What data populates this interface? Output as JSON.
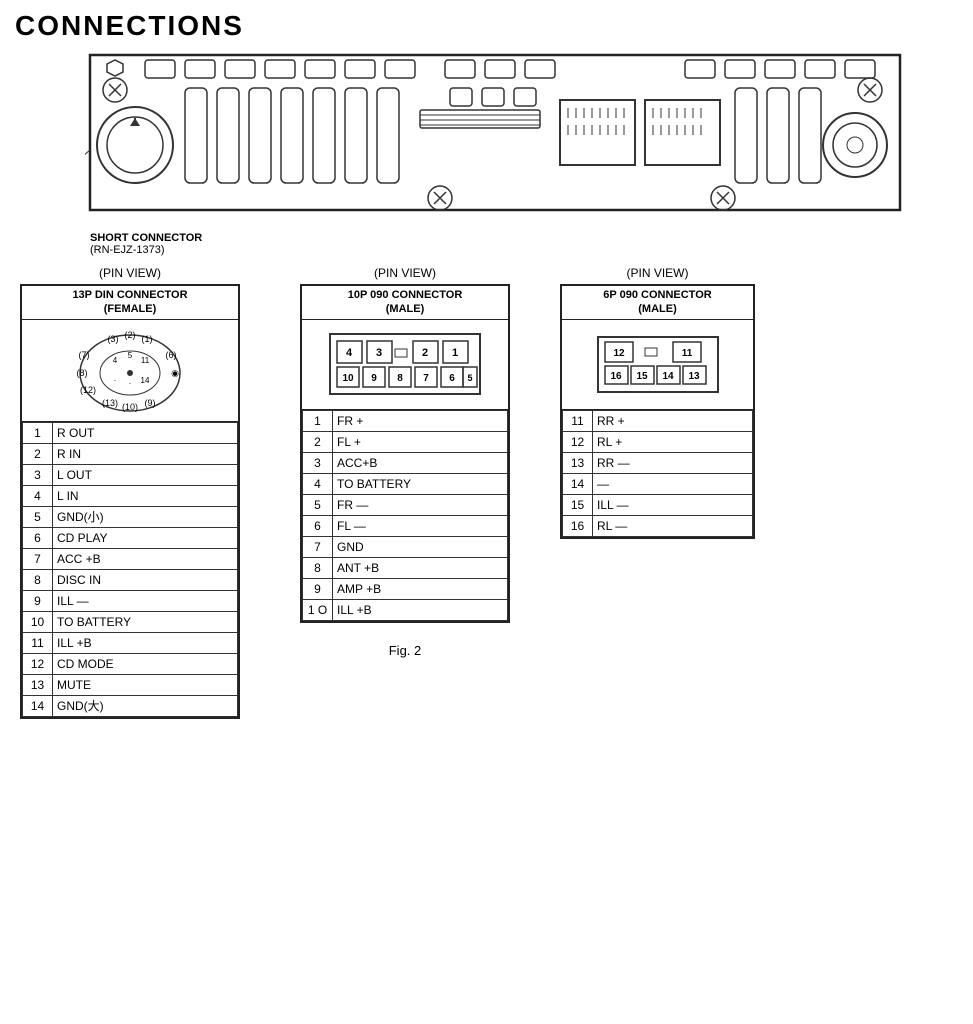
{
  "page": {
    "title": "CONNECTIONS",
    "fig_label": "Fig. 2",
    "short_connector": {
      "label_line1": "SHORT CONNECTOR",
      "label_line2": "(RN-EJZ-1373)"
    }
  },
  "pin_view_label": "(PIN  VIEW)",
  "connectors": [
    {
      "id": "13p-din",
      "title_line1": "13P DIN CONNECTOR",
      "title_line2": "(FEMALE)",
      "type": "din-circle",
      "pins": [
        {
          "num": "1",
          "label": "R OUT"
        },
        {
          "num": "2",
          "label": "R IN"
        },
        {
          "num": "3",
          "label": "L OUT"
        },
        {
          "num": "4",
          "label": "L IN"
        },
        {
          "num": "5",
          "label": "GND(小)"
        },
        {
          "num": "6",
          "label": "CD PLAY"
        },
        {
          "num": "7",
          "label": "ACC +B"
        },
        {
          "num": "8",
          "label": "DISC IN"
        },
        {
          "num": "9",
          "label": "ILL —"
        },
        {
          "num": "10",
          "label": "TO BATTERY"
        },
        {
          "num": "11",
          "label": "ILL +B"
        },
        {
          "num": "12",
          "label": "CD MODE"
        },
        {
          "num": "13",
          "label": "MUTE"
        },
        {
          "num": "14",
          "label": "GND(大)"
        }
      ]
    },
    {
      "id": "10p-090",
      "title_line1": "10P 090 CONNECTOR",
      "title_line2": "(MALE)",
      "type": "grid-10p",
      "grid_top": [
        "4",
        "3",
        "",
        "2",
        "1"
      ],
      "grid_bot": [
        "10",
        "9",
        "8",
        "7",
        "6",
        "5"
      ],
      "pins": [
        {
          "num": "1",
          "label": "FR +"
        },
        {
          "num": "2",
          "label": "FL +"
        },
        {
          "num": "3",
          "label": "ACC+B"
        },
        {
          "num": "4",
          "label": "TO BATTERY"
        },
        {
          "num": "5",
          "label": "FR —"
        },
        {
          "num": "6",
          "label": "FL —"
        },
        {
          "num": "7",
          "label": "GND"
        },
        {
          "num": "8",
          "label": "ANT +B"
        },
        {
          "num": "9",
          "label": "AMP +B"
        },
        {
          "num": "10",
          "label": "ILL +B"
        }
      ]
    },
    {
      "id": "6p-090",
      "title_line1": "6P 090 CONNECTOR",
      "title_line2": "(MALE)",
      "type": "grid-6p",
      "grid_top": [
        "12",
        "",
        "11"
      ],
      "grid_bot": [
        "16",
        "15",
        "14",
        "13"
      ],
      "pins": [
        {
          "num": "11",
          "label": "RR +"
        },
        {
          "num": "12",
          "label": "RL +"
        },
        {
          "num": "13",
          "label": "RR —"
        },
        {
          "num": "14",
          "label": "—"
        },
        {
          "num": "15",
          "label": "ILL —"
        },
        {
          "num": "16",
          "label": "RL —"
        }
      ]
    }
  ]
}
